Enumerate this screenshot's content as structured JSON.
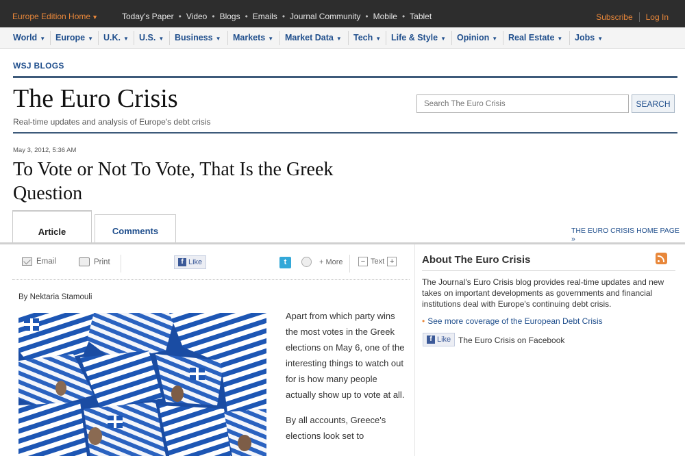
{
  "topbar": {
    "edition": "Europe Edition Home",
    "links": [
      "Today's Paper",
      "Video",
      "Blogs",
      "Emails",
      "Journal Community",
      "Mobile",
      "Tablet"
    ],
    "subscribe": "Subscribe",
    "login": "Log In"
  },
  "nav": [
    "World",
    "Europe",
    "U.K.",
    "U.S.",
    "Business",
    "Markets",
    "Market Data",
    "Tech",
    "Life & Style",
    "Opinion",
    "Real Estate",
    "Jobs"
  ],
  "blog": {
    "section": "WSJ BLOGS",
    "title": "The Euro Crisis",
    "tagline": "Real-time updates and analysis of Europe's debt crisis",
    "search_placeholder": "Search The Euro Crisis",
    "search_button": "SEARCH"
  },
  "post": {
    "date": "May 3, 2012, 5:36 AM",
    "title": "To Vote or Not To Vote, That Is the Greek Question",
    "byline": "By Nektaria Stamouli",
    "paragraphs": [
      "Apart from which party wins the most votes in the Greek elections on May 6, one of the interesting things to watch out for is how many people actually show up to vote at all.",
      "By all accounts, Greece's elections look set to"
    ]
  },
  "tabs": {
    "article": "Article",
    "comments": "Comments",
    "home_link": "THE EURO CRISIS HOME PAGE »"
  },
  "tools": {
    "email": "Email",
    "print": "Print",
    "like": "Like",
    "more": "+ More",
    "text": "Text",
    "minus": "−",
    "plus": "+"
  },
  "sidebar": {
    "title": "About The Euro Crisis",
    "description": "The Journal's Euro Crisis blog provides real-time updates and new takes on important developments as governments and financial institutions deal with Europe's continuing debt crisis.",
    "link": "See more coverage of the European Debt Crisis",
    "like": "Like",
    "facebook_text": "The Euro Crisis on Facebook"
  },
  "colors": {
    "accent_orange": "#e8873a",
    "link_blue": "#1f4e8c",
    "topbar_bg": "#2d2d2d",
    "rule_blue": "#3d5a7a"
  }
}
